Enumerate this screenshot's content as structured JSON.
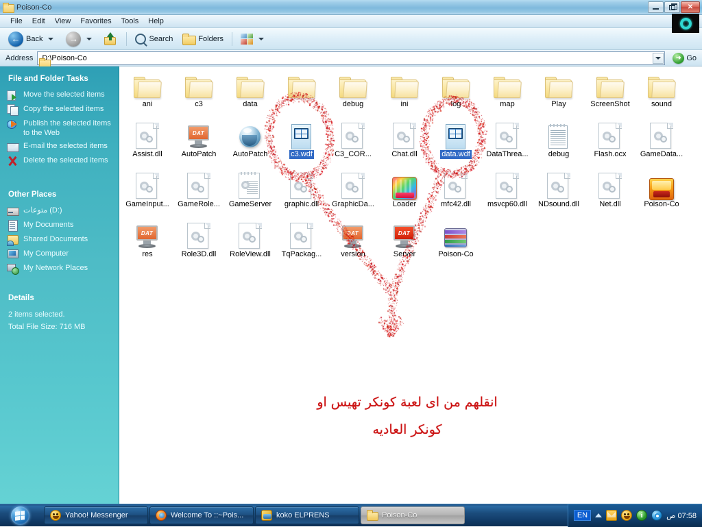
{
  "window": {
    "title": "Poison-Co",
    "title_icon": "folder-icon",
    "buttons": {
      "minimize": "minimize-button",
      "restore": "restore-button",
      "close": "close-button"
    },
    "logo": "teal-ring-logo"
  },
  "menubar": {
    "items": [
      {
        "label": "File"
      },
      {
        "label": "Edit"
      },
      {
        "label": "View"
      },
      {
        "label": "Favorites"
      },
      {
        "label": "Tools"
      },
      {
        "label": "Help"
      }
    ]
  },
  "toolbar": {
    "back_label": "Back",
    "search_label": "Search",
    "folders_label": "Folders",
    "icons": [
      "back-arrow-icon",
      "forward-arrow-icon",
      "up-folder-icon",
      "search-icon",
      "folders-icon",
      "views-icon"
    ]
  },
  "address": {
    "label": "Address",
    "value": "D:\\Poison-Co",
    "go_label": "Go",
    "icon": "folder-icon"
  },
  "sidebar": {
    "tasks_panel": {
      "title": "File and Folder Tasks",
      "items": [
        {
          "label": "Move the selected items",
          "icon": "move-icon"
        },
        {
          "label": "Copy the selected items",
          "icon": "copy-icon"
        },
        {
          "label": "Publish the selected items to the Web",
          "icon": "publish-web-icon"
        },
        {
          "label": "E-mail the selected items",
          "icon": "email-icon"
        },
        {
          "label": "Delete the selected items",
          "icon": "delete-x-icon"
        }
      ]
    },
    "other_places_panel": {
      "title": "Other Places",
      "items": [
        {
          "label": "متوعات (D:)",
          "icon": "drive-icon"
        },
        {
          "label": "My Documents",
          "icon": "documents-icon"
        },
        {
          "label": "Shared Documents",
          "icon": "shared-documents-icon"
        },
        {
          "label": "My Computer",
          "icon": "computer-icon"
        },
        {
          "label": "My Network Places",
          "icon": "network-places-icon"
        }
      ]
    },
    "details_panel": {
      "title": "Details",
      "selection": "2 items selected.",
      "size": "Total File Size: 716 MB"
    }
  },
  "files": {
    "items": [
      {
        "name": "ani",
        "icon": "folder",
        "type": "folder",
        "selected": false
      },
      {
        "name": "c3",
        "icon": "folder",
        "type": "folder",
        "selected": false
      },
      {
        "name": "data",
        "icon": "folder",
        "type": "folder",
        "selected": false
      },
      {
        "name": "",
        "icon": "folder",
        "type": "folder",
        "selected": false,
        "obscured": true
      },
      {
        "name": "debug",
        "icon": "folder",
        "type": "folder",
        "selected": false
      },
      {
        "name": "ini",
        "icon": "folder",
        "type": "folder",
        "selected": false
      },
      {
        "name": "log",
        "icon": "folder",
        "type": "folder",
        "selected": false
      },
      {
        "name": "map",
        "icon": "folder",
        "type": "folder",
        "selected": false
      },
      {
        "name": "Play",
        "icon": "folder",
        "type": "folder",
        "selected": false
      },
      {
        "name": "ScreenShot",
        "icon": "folder",
        "type": "folder",
        "selected": false
      },
      {
        "name": "sound",
        "icon": "folder",
        "type": "folder",
        "selected": false
      },
      {
        "name": "Assist.dll",
        "icon": "dll",
        "type": "file",
        "selected": false
      },
      {
        "name": "AutoPatch",
        "icon": "dat",
        "type": "file",
        "selected": false
      },
      {
        "name": "AutoPatch",
        "icon": "globe",
        "type": "file",
        "selected": false
      },
      {
        "name": "c3.wdf",
        "icon": "wdf",
        "type": "file",
        "selected": true
      },
      {
        "name": "C3_COR...",
        "icon": "dll",
        "type": "file",
        "selected": false
      },
      {
        "name": "Chat.dll",
        "icon": "dll",
        "type": "file",
        "selected": false
      },
      {
        "name": "data.wdf",
        "icon": "wdf",
        "type": "file",
        "selected": true
      },
      {
        "name": "DataThrea...",
        "icon": "dll",
        "type": "file",
        "selected": false
      },
      {
        "name": "debug",
        "icon": "txt",
        "type": "file",
        "selected": false
      },
      {
        "name": "Flash.ocx",
        "icon": "dll",
        "type": "file",
        "selected": false
      },
      {
        "name": "GameData...",
        "icon": "dll",
        "type": "file",
        "selected": false
      },
      {
        "name": "GameInput...",
        "icon": "dll",
        "type": "file",
        "selected": false
      },
      {
        "name": "GameRole...",
        "icon": "dll",
        "type": "file",
        "selected": false
      },
      {
        "name": "GameServer",
        "icon": "gsrv",
        "type": "file",
        "selected": false
      },
      {
        "name": "graphic.dll",
        "icon": "dll",
        "type": "file",
        "selected": false
      },
      {
        "name": "GraphicDa...",
        "icon": "dll",
        "type": "file",
        "selected": false
      },
      {
        "name": "Loader",
        "icon": "game",
        "type": "file",
        "selected": false
      },
      {
        "name": "mfc42.dll",
        "icon": "dll",
        "type": "file",
        "selected": false
      },
      {
        "name": "msvcp60.dll",
        "icon": "dll",
        "type": "file",
        "selected": false
      },
      {
        "name": "NDsound.dll",
        "icon": "dll",
        "type": "file",
        "selected": false
      },
      {
        "name": "Net.dll",
        "icon": "dll",
        "type": "file",
        "selected": false
      },
      {
        "name": "Poison-Co",
        "icon": "poison",
        "type": "file",
        "selected": false
      },
      {
        "name": "res",
        "icon": "dat",
        "type": "file",
        "selected": false
      },
      {
        "name": "Role3D.dll",
        "icon": "dll",
        "type": "file",
        "selected": false
      },
      {
        "name": "RoleView.dll",
        "icon": "dll",
        "type": "file",
        "selected": false
      },
      {
        "name": "TqPackag...",
        "icon": "dll",
        "type": "file",
        "selected": false
      },
      {
        "name": "version",
        "icon": "dat",
        "type": "file",
        "selected": false
      },
      {
        "name": "Server",
        "icon": "datred",
        "type": "file",
        "selected": false
      },
      {
        "name": "Poison-Co",
        "icon": "rar",
        "type": "file",
        "selected": false
      }
    ]
  },
  "annotation": {
    "line1": "انقلهم من اى لعبة كونكر تهيس او",
    "line2": "كونكر العاديه",
    "color": "#cc1111"
  },
  "taskbar": {
    "start": "start-button",
    "tasks": [
      {
        "label": "Yahoo! Messenger",
        "icon": "yahoo-messenger-icon",
        "active": false
      },
      {
        "label": "Welcome To ::~Pois...",
        "icon": "firefox-icon",
        "active": false
      },
      {
        "label": "koko ELPRENS",
        "icon": "koko-icon",
        "active": false
      },
      {
        "label": "Poison-Co",
        "icon": "folder-icon",
        "active": true
      }
    ],
    "tray": {
      "language": "EN",
      "icons": [
        "show-hidden-icons-arrow",
        "mail-icon",
        "yahoo-messenger-icon",
        "info-icon",
        "media-icon"
      ],
      "clock": "07:58 ص"
    }
  }
}
